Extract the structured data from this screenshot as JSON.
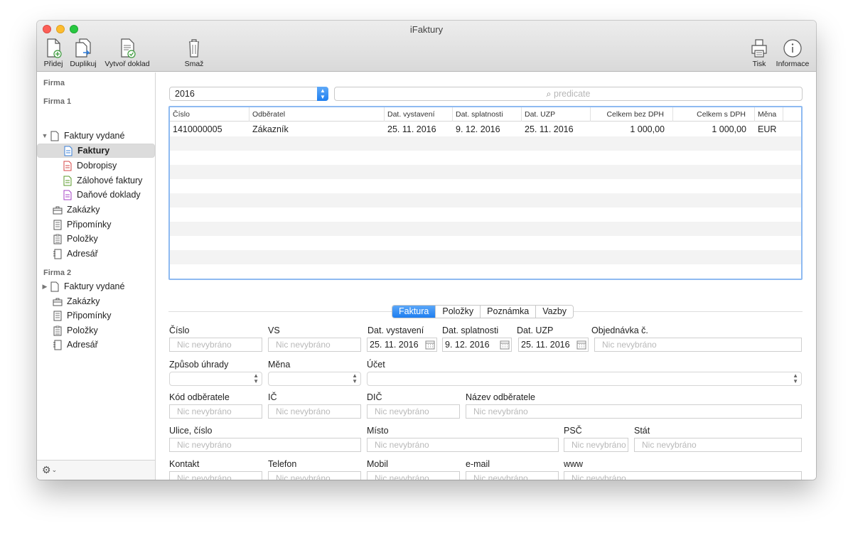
{
  "window": {
    "title": "iFaktury"
  },
  "toolbar": {
    "add": "Přidej",
    "duplicate": "Duplikuj",
    "create_document": "Vytvoř doklad",
    "delete": "Smaž",
    "print": "Tisk",
    "info": "Informace"
  },
  "sidebar": {
    "header": "Firma",
    "firm1": {
      "name": "Firma 1",
      "issued": "Faktury vydané",
      "invoices": "Faktury",
      "credit_notes": "Dobropisy",
      "advance_invoices": "Zálohové faktury",
      "tax_documents": "Daňové doklady",
      "orders": "Zakázky",
      "reminders": "Připomínky",
      "items": "Položky",
      "address_book": "Adresář"
    },
    "firm2": {
      "name": "Firma 2",
      "issued": "Faktury vydané",
      "orders": "Zakázky",
      "reminders": "Připomínky",
      "items": "Položky",
      "address_book": "Adresář"
    },
    "settings_icon": "gear-icon"
  },
  "filter": {
    "year": "2016",
    "search_placeholder": "predicate"
  },
  "table": {
    "columns": [
      "Číslo",
      "Odběratel",
      "Dat. vystavení",
      "Dat. splatnosti",
      "Dat. UZP",
      "Celkem bez DPH",
      "Celkem s DPH",
      "Měna"
    ],
    "rows": [
      [
        "1410000005",
        "Zákazník",
        "25. 11. 2016",
        "9. 12. 2016",
        "25. 11. 2016",
        "1 000,00",
        "1 000,00",
        "EUR"
      ]
    ]
  },
  "tabs": [
    "Faktura",
    "Položky",
    "Poznámka",
    "Vazby"
  ],
  "form": {
    "placeholder": "Nic nevybráno",
    "labels": {
      "number": "Číslo",
      "vs": "VS",
      "issue_date": "Dat. vystavení",
      "due_date": "Dat. splatnosti",
      "uzp_date": "Dat. UZP",
      "order_no": "Objednávka č.",
      "payment_method": "Způsob úhrady",
      "currency": "Měna",
      "account": "Účet",
      "customer_code": "Kód odběratele",
      "ic": "IČ",
      "dic": "DIČ",
      "customer_name": "Název odběratele",
      "street": "Ulice, číslo",
      "city": "Místo",
      "zip": "PSČ",
      "country": "Stát",
      "contact": "Kontakt",
      "phone": "Telefon",
      "mobile": "Mobil",
      "email": "e-mail",
      "www": "www"
    },
    "values": {
      "issue_date": "25. 11. 2016",
      "due_date": "9. 12. 2016",
      "uzp_date": "25. 11. 2016"
    }
  },
  "colors": {
    "accent": "#1e7ef0",
    "selection": "#dcdcdc",
    "table_focus": "#8ebaf1"
  }
}
